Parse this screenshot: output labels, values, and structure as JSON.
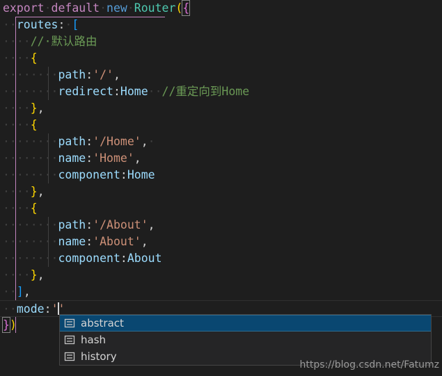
{
  "editor": {
    "background_color": "#1e1e1e",
    "font_size_px": 16.5,
    "line_height_px": 24,
    "language": "javascript",
    "colors": {
      "keyword_control": "#c586c0",
      "keyword": "#569cd6",
      "type": "#4ec9b0",
      "property": "#9cdcfe",
      "string": "#ce9178",
      "comment": "#6a9955",
      "punctuation": "#d4d4d4",
      "bracket_yellow": "#ffd700",
      "bracket_pink": "#da70d6",
      "bracket_blue": "#179fff",
      "whitespace_dot": "#404040",
      "indent_guide": "#404040",
      "indent_guide_active": "#c586c0",
      "selection": "#094771"
    },
    "lines": [
      {
        "n": 1,
        "text": "export default new Router({",
        "tokens": [
          {
            "t": "export",
            "c": "kw"
          },
          {
            "t": "·",
            "c": "ws"
          },
          {
            "t": "default",
            "c": "kw"
          },
          {
            "t": "·",
            "c": "ws"
          },
          {
            "t": "new",
            "c": "kw2"
          },
          {
            "t": "·",
            "c": "ws"
          },
          {
            "t": "Router",
            "c": "type"
          },
          {
            "t": "(",
            "c": "br-yellow"
          },
          {
            "t": "{",
            "c": "br-pink match"
          }
        ]
      },
      {
        "n": 2,
        "text": "  routes: [",
        "tokens": [
          {
            "t": "··",
            "c": "ws"
          },
          {
            "t": "routes",
            "c": "prop"
          },
          {
            "t": ":",
            "c": "punct"
          },
          {
            "t": "·",
            "c": "ws"
          },
          {
            "t": "[",
            "c": "br-blue"
          }
        ]
      },
      {
        "n": 3,
        "text": "    // 默认路由",
        "tokens": [
          {
            "t": "····",
            "c": "ws"
          },
          {
            "t": "//·默认路由",
            "c": "cmt"
          }
        ]
      },
      {
        "n": 4,
        "text": "    {",
        "tokens": [
          {
            "t": "····",
            "c": "ws"
          },
          {
            "t": "{",
            "c": "br-yellow"
          }
        ]
      },
      {
        "n": 5,
        "text": "      path:'/',",
        "tokens": [
          {
            "t": "····",
            "c": "ws"
          },
          {
            "t": "····",
            "c": "ws"
          },
          {
            "t": "path",
            "c": "prop"
          },
          {
            "t": ":",
            "c": "punct"
          },
          {
            "t": "'/'",
            "c": "str"
          },
          {
            "t": ",",
            "c": "punct"
          }
        ]
      },
      {
        "n": 6,
        "text": "      redirect:Home  //重定向到Home",
        "tokens": [
          {
            "t": "····",
            "c": "ws"
          },
          {
            "t": "····",
            "c": "ws"
          },
          {
            "t": "redirect",
            "c": "prop"
          },
          {
            "t": ":",
            "c": "punct"
          },
          {
            "t": "Home",
            "c": "prop"
          },
          {
            "t": "··",
            "c": "ws"
          },
          {
            "t": "//重定向到Home",
            "c": "cmt"
          }
        ]
      },
      {
        "n": 7,
        "text": "    },",
        "tokens": [
          {
            "t": "····",
            "c": "ws"
          },
          {
            "t": "}",
            "c": "br-yellow"
          },
          {
            "t": ",",
            "c": "punct"
          }
        ]
      },
      {
        "n": 8,
        "text": "    {",
        "tokens": [
          {
            "t": "····",
            "c": "ws"
          },
          {
            "t": "{",
            "c": "br-yellow"
          }
        ]
      },
      {
        "n": 9,
        "text": "      path:'/Home',",
        "tokens": [
          {
            "t": "····",
            "c": "ws"
          },
          {
            "t": "····",
            "c": "ws"
          },
          {
            "t": "path",
            "c": "prop"
          },
          {
            "t": ":",
            "c": "punct"
          },
          {
            "t": "'/Home'",
            "c": "str"
          },
          {
            "t": ",",
            "c": "punct"
          },
          {
            "t": "·",
            "c": "ws"
          }
        ]
      },
      {
        "n": 10,
        "text": "      name:'Home',",
        "tokens": [
          {
            "t": "····",
            "c": "ws"
          },
          {
            "t": "····",
            "c": "ws"
          },
          {
            "t": "name",
            "c": "prop"
          },
          {
            "t": ":",
            "c": "punct"
          },
          {
            "t": "'Home'",
            "c": "str"
          },
          {
            "t": ",",
            "c": "punct"
          }
        ]
      },
      {
        "n": 11,
        "text": "      component:Home",
        "tokens": [
          {
            "t": "····",
            "c": "ws"
          },
          {
            "t": "····",
            "c": "ws"
          },
          {
            "t": "component",
            "c": "prop"
          },
          {
            "t": ":",
            "c": "punct"
          },
          {
            "t": "Home",
            "c": "prop"
          }
        ]
      },
      {
        "n": 12,
        "text": "    },",
        "tokens": [
          {
            "t": "····",
            "c": "ws"
          },
          {
            "t": "}",
            "c": "br-yellow"
          },
          {
            "t": ",",
            "c": "punct"
          }
        ]
      },
      {
        "n": 13,
        "text": "    {",
        "tokens": [
          {
            "t": "····",
            "c": "ws"
          },
          {
            "t": "{",
            "c": "br-yellow"
          }
        ]
      },
      {
        "n": 14,
        "text": "      path:'/About',",
        "tokens": [
          {
            "t": "····",
            "c": "ws"
          },
          {
            "t": "····",
            "c": "ws"
          },
          {
            "t": "path",
            "c": "prop"
          },
          {
            "t": ":",
            "c": "punct"
          },
          {
            "t": "'/About'",
            "c": "str"
          },
          {
            "t": ",",
            "c": "punct"
          }
        ]
      },
      {
        "n": 15,
        "text": "      name:'About',",
        "tokens": [
          {
            "t": "····",
            "c": "ws"
          },
          {
            "t": "····",
            "c": "ws"
          },
          {
            "t": "name",
            "c": "prop"
          },
          {
            "t": ":",
            "c": "punct"
          },
          {
            "t": "'About'",
            "c": "str"
          },
          {
            "t": ",",
            "c": "punct"
          }
        ]
      },
      {
        "n": 16,
        "text": "      component:About",
        "tokens": [
          {
            "t": "····",
            "c": "ws"
          },
          {
            "t": "····",
            "c": "ws"
          },
          {
            "t": "component",
            "c": "prop"
          },
          {
            "t": ":",
            "c": "punct"
          },
          {
            "t": "About",
            "c": "prop"
          }
        ]
      },
      {
        "n": 17,
        "text": "    },",
        "tokens": [
          {
            "t": "····",
            "c": "ws"
          },
          {
            "t": "}",
            "c": "br-yellow"
          },
          {
            "t": ",",
            "c": "punct"
          }
        ]
      },
      {
        "n": 18,
        "text": "  ],",
        "tokens": [
          {
            "t": "··",
            "c": "ws"
          },
          {
            "t": "]",
            "c": "br-blue"
          },
          {
            "t": ",",
            "c": "punct"
          }
        ]
      },
      {
        "n": 19,
        "text": "  mode:'|'",
        "current": true,
        "tokens": [
          {
            "t": "··",
            "c": "ws"
          },
          {
            "t": "mode",
            "c": "prop"
          },
          {
            "t": ":",
            "c": "punct"
          },
          {
            "t": "'",
            "c": "str"
          },
          {
            "t": "CARET",
            "c": "caret"
          },
          {
            "t": "'",
            "c": "str"
          }
        ]
      },
      {
        "n": 20,
        "text": "})",
        "tokens": [
          {
            "t": "}",
            "c": "br-pink match"
          },
          {
            "t": ")",
            "c": "br-yellow"
          }
        ]
      }
    ]
  },
  "suggest_widget": {
    "visible": true,
    "selected_index": 0,
    "items": [
      {
        "label": "abstract",
        "icon": "enum-icon",
        "selected": true
      },
      {
        "label": "hash",
        "icon": "enum-icon",
        "selected": false
      },
      {
        "label": "history",
        "icon": "enum-icon",
        "selected": false
      }
    ]
  },
  "watermark": {
    "text": "https://blog.csdn.net/Fatumz"
  }
}
